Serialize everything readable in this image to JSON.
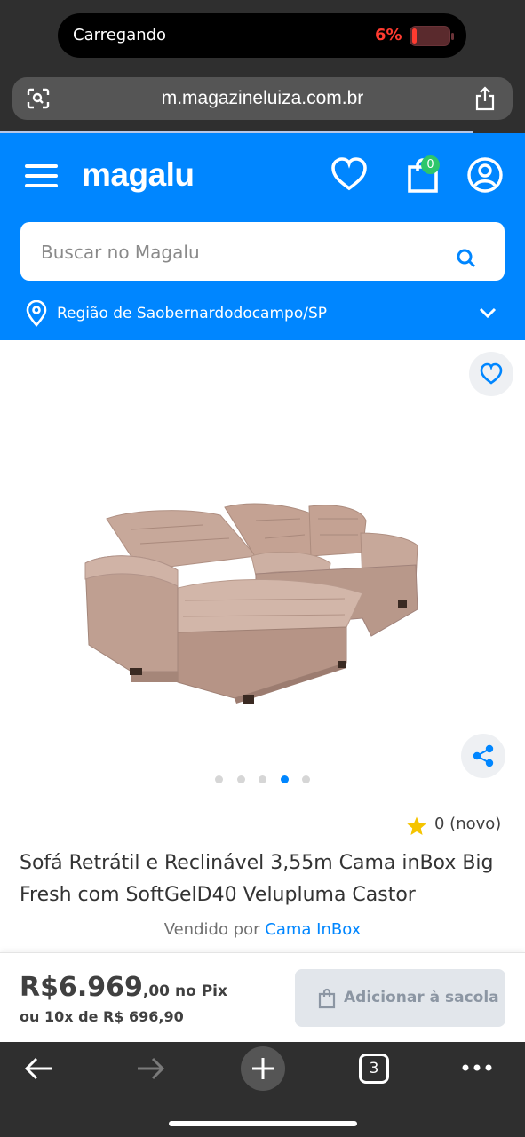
{
  "status": {
    "charging_label": "Carregando",
    "battery_percent": "6%",
    "battery_level": 0.06
  },
  "browser": {
    "url": "m.magazineluiza.com.br",
    "tab_count": "3"
  },
  "header": {
    "logo": "magalu",
    "bag_count": "0",
    "search_placeholder": "Buscar no Magalu",
    "region": "Região de Saobernardodocampo/SP"
  },
  "product": {
    "image_alt": "sofa-image",
    "carousel": {
      "total": 5,
      "active_index": 3
    },
    "rating": "0 (novo)",
    "title": "Sofá Retrátil e Reclinável 3,55m Cama inBox Big Fresh com SoftGelD40 Velupluma Castor",
    "seller_prefix": "Vendido por",
    "seller_name": "Cama InBox"
  },
  "buy": {
    "price_main": "R$6.969",
    "price_cents": ",00",
    "price_suffix": "no Pix",
    "installments": "ou 10x de R$ 696,90",
    "add_button": "Adicionar à sacola"
  },
  "colors": {
    "brand_blue": "#0086ff",
    "badge_green": "#2ec66b",
    "battery_red": "#ff3b30",
    "star": "#f5c400"
  },
  "icons": [
    "lens-icon",
    "share-icon",
    "menu-icon",
    "heart-icon",
    "bag-icon",
    "user-icon",
    "search-icon",
    "location-pin-icon",
    "chevron-down-icon",
    "star-icon",
    "back-icon",
    "forward-icon",
    "plus-icon",
    "more-icon"
  ]
}
